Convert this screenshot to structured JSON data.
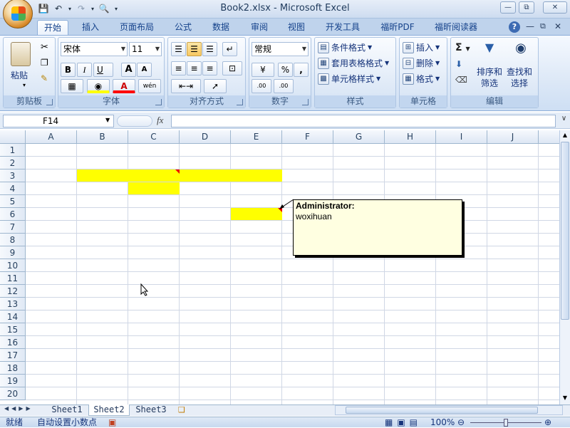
{
  "window": {
    "title": "Book2.xlsx - Microsoft Excel",
    "controls": [
      "minimize-icon",
      "restore-icon",
      "close-icon"
    ]
  },
  "quick_access": [
    "save-icon",
    "undo-icon",
    "redo-icon",
    "print-preview-icon",
    "customize-qat-icon"
  ],
  "tabs": [
    "开始",
    "插入",
    "页面布局",
    "公式",
    "数据",
    "审阅",
    "视图",
    "开发工具",
    "福昕PDF",
    "福昕阅读器"
  ],
  "active_tab": "开始",
  "ribbon": {
    "clipboard": {
      "label": "剪贴板",
      "paste": "粘贴"
    },
    "font": {
      "label": "字体",
      "font_name": "宋体",
      "font_size": "11",
      "bold": "B",
      "italic": "I",
      "underline": "U",
      "grow": "A",
      "shrink": "A",
      "phonetic": "wén"
    },
    "alignment": {
      "label": "对齐方式"
    },
    "number": {
      "label": "数字",
      "format": "常规",
      "percent": "%",
      "comma": ",",
      "inc_decimal": ".00",
      "dec_decimal": ".00"
    },
    "styles": {
      "label": "样式",
      "conditional": "条件格式",
      "table": "套用表格格式",
      "cell_styles": "单元格样式"
    },
    "cells": {
      "label": "单元格",
      "insert": "插入",
      "delete": "删除",
      "format": "格式"
    },
    "editing": {
      "label": "编辑",
      "sort_filter": [
        "排序和",
        "筛选"
      ],
      "find_select": [
        "查找和",
        "选择"
      ],
      "sum": "Σ"
    }
  },
  "formula_bar": {
    "name_box": "F14",
    "fx": "fx",
    "formula": ""
  },
  "columns": [
    "A",
    "B",
    "C",
    "D",
    "E",
    "F",
    "G",
    "H",
    "I",
    "J"
  ],
  "rows": [
    "1",
    "2",
    "3",
    "4",
    "5",
    "6",
    "7",
    "8",
    "9",
    "10",
    "11",
    "12",
    "13",
    "14",
    "15",
    "16",
    "17",
    "18",
    "19",
    "20"
  ],
  "highlighted_cells": [
    "B3",
    "C3",
    "D3",
    "E3",
    "C4",
    "E6"
  ],
  "highlight_color": "#ffff00",
  "comment": {
    "author": "Administrator:",
    "text": "woxihuan"
  },
  "sheets": [
    "Sheet1",
    "Sheet2",
    "Sheet3"
  ],
  "active_sheet": "Sheet2",
  "status": {
    "mode": "就绪",
    "auto_decimal": "自动设置小数点",
    "zoom": "100%"
  }
}
